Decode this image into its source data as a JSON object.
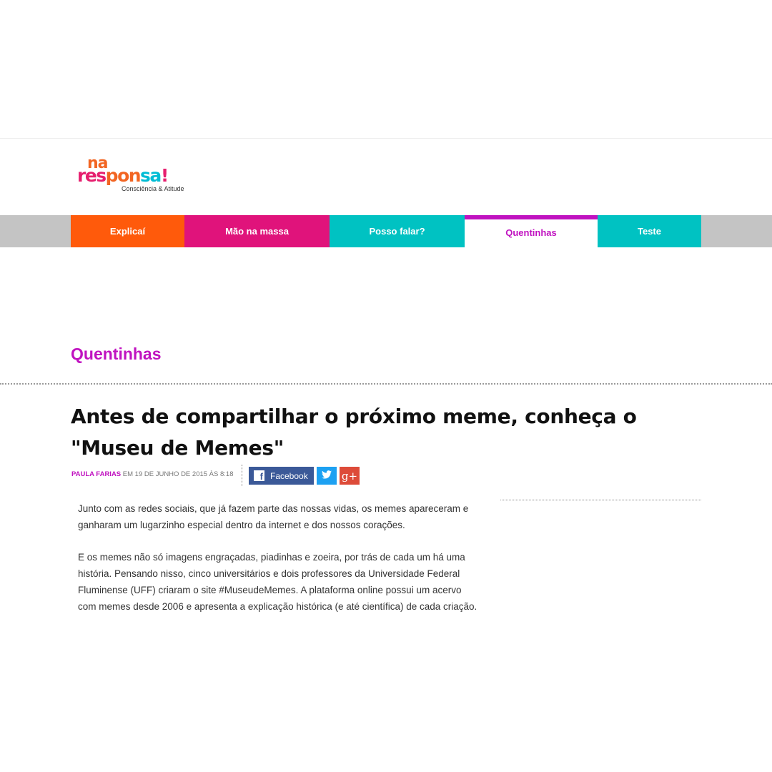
{
  "logo": {
    "line1": "na",
    "line2_parts": [
      "res",
      "pon",
      "sa",
      "!"
    ],
    "tagline": "Consciência & Atitude"
  },
  "nav": {
    "items": [
      {
        "label": "Explicaí"
      },
      {
        "label": "Mão na massa"
      },
      {
        "label": "Posso falar?"
      },
      {
        "label": "Quentinhas"
      },
      {
        "label": "Teste"
      }
    ],
    "active": "Quentinhas"
  },
  "section": {
    "title": "Quentinhas"
  },
  "article": {
    "headline": "Antes de compartilhar o próximo meme, conheça o \"Museu de Memes\"",
    "author": "PAULA FARIAS",
    "date": " EM 19 DE JUNHO DE 2015 ÀS 8:18",
    "paragraphs": [
      "Junto com as redes sociais, que já fazem parte das nossas vidas, os memes apareceram e ganharam um lugarzinho especial dentro da internet e dos nossos corações.",
      "E os memes não só imagens engraçadas, piadinhas e zoeira, por trás de cada um há uma história. Pensando nisso, cinco universitários e dois professores da Universidade Federal Fluminense (UFF) criaram o site #MuseudeMemes. A plataforma online possui um acervo com memes desde 2006 e apresenta a explicação histórica (e até científica) de cada criação."
    ]
  },
  "share": {
    "facebook_label": "Facebook",
    "facebook_glyph": "f",
    "googleplus_glyph": "g+",
    "icons": [
      "facebook-icon",
      "twitter-icon",
      "google-plus-icon"
    ]
  },
  "colors": {
    "explicai": "#ff5a0b",
    "mao_na_massa": "#e0137b",
    "posso_falar": "#00c2c2",
    "quentinhas": "#c012c0",
    "teste": "#00c2c2",
    "facebook": "#3b5998",
    "twitter": "#1da1f2",
    "googleplus": "#dd4b39"
  }
}
